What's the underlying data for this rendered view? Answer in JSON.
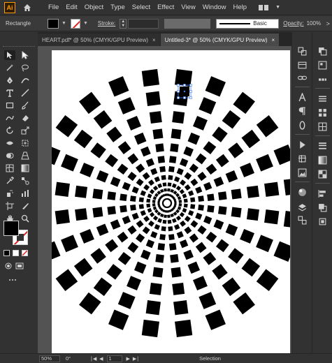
{
  "app": {
    "logo": "Ai"
  },
  "menu": [
    "File",
    "Edit",
    "Object",
    "Type",
    "Select",
    "Effect",
    "View",
    "Window",
    "Help"
  ],
  "control_bar": {
    "object_type": "Rectangle",
    "stroke_label": "Stroke:",
    "brush_name": "Basic",
    "opacity_label": "Opacity:",
    "opacity_value": "100%",
    "more": ">"
  },
  "tabs": [
    {
      "label": "HEART.pdf* @ 50% (CMYK/GPU Preview)",
      "close": "×",
      "active": false
    },
    {
      "label": "Untitled-3* @ 50% (CMYK/GPU Preview)",
      "close": "×",
      "active": true
    }
  ],
  "status_bar": {
    "zoom": "50%",
    "rotation": "0°",
    "page": "1",
    "tool": "Selection"
  },
  "colors": {
    "fill": "#000000",
    "stroke_none_slash": "#e02020",
    "artboard": "#ffffff",
    "pasteboard": "#535353",
    "ui_dark": "#323232",
    "logo_accent": "#ff9a00",
    "selection": "#3b7cff"
  },
  "icons": {
    "toolbar": [
      "selection-icon",
      "direct-selection-icon",
      "magic-wand-icon",
      "lasso-icon",
      "pen-icon",
      "curvature-icon",
      "type-icon",
      "line-icon",
      "rectangle-icon",
      "paintbrush-icon",
      "shaper-icon",
      "eraser-icon",
      "rotate-icon",
      "scale-icon",
      "width-icon",
      "free-transform-icon",
      "shape-builder-icon",
      "perspective-icon",
      "mesh-icon",
      "gradient-icon",
      "eyedropper-icon",
      "blend-icon",
      "symbol-sprayer-icon",
      "graph-icon",
      "artboard-icon",
      "slice-icon",
      "hand-icon",
      "zoom-icon"
    ],
    "panels": [
      "properties-icon",
      "layers-icon",
      "libraries-icon",
      "swatches-icon",
      "brushes-icon",
      "symbols-icon",
      "character-icon",
      "paragraph-icon",
      "opentype-icon",
      "actions-icon",
      "links-icon",
      "appearance-icon",
      "graphic-styles-icon",
      "color-icon",
      "color-guide-icon",
      "transparency-icon",
      "gradient-panel-icon",
      "stroke-panel-icon",
      "align-icon",
      "transform-icon",
      "pathfinder-icon"
    ]
  }
}
